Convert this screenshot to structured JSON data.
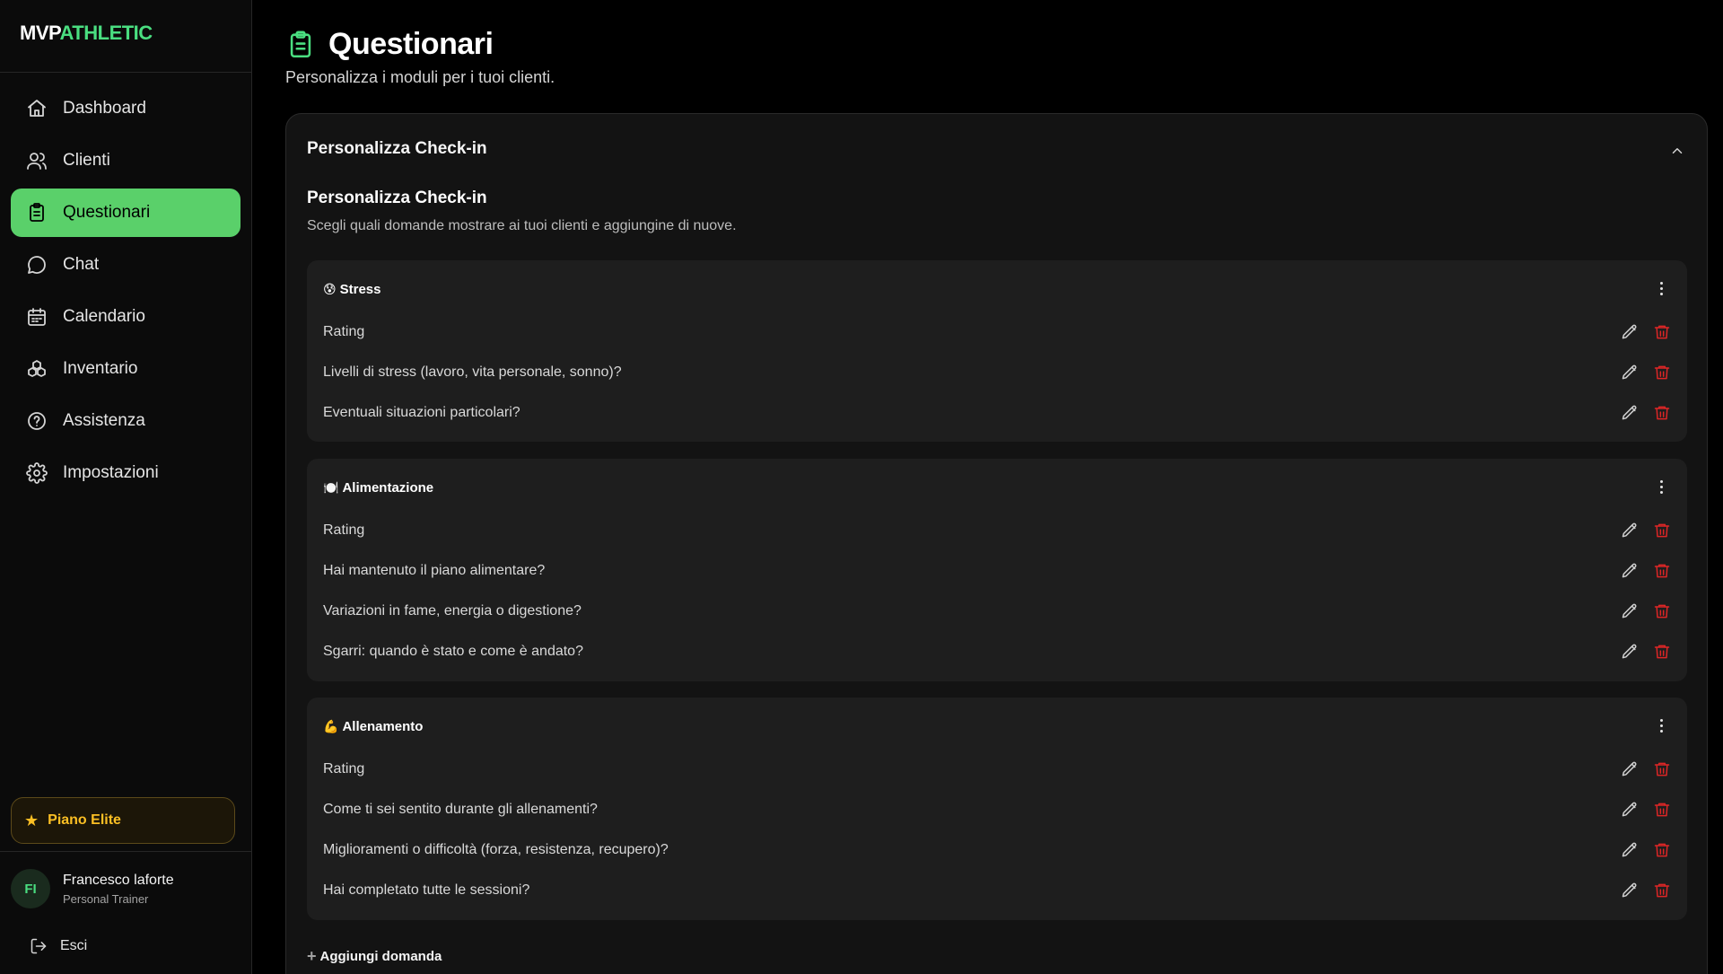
{
  "brand": {
    "part1": "MVP",
    "part2": "ATHLETIC"
  },
  "sidebar": {
    "items": [
      {
        "label": "Dashboard",
        "icon": "home-icon"
      },
      {
        "label": "Clienti",
        "icon": "users-icon"
      },
      {
        "label": "Questionari",
        "icon": "clipboard-icon",
        "active": true
      },
      {
        "label": "Chat",
        "icon": "chat-icon"
      },
      {
        "label": "Calendario",
        "icon": "calendar-icon"
      },
      {
        "label": "Inventario",
        "icon": "inventory-icon"
      },
      {
        "label": "Assistenza",
        "icon": "help-icon"
      },
      {
        "label": "Impostazioni",
        "icon": "gear-icon"
      }
    ],
    "plan": "Piano Elite",
    "user": {
      "initials": "FI",
      "name": "Francesco laforte",
      "role": "Personal Trainer"
    },
    "logout": "Esci"
  },
  "header": {
    "title": "Questionari",
    "subtitle": "Personalizza i moduli per i tuoi clienti."
  },
  "card": {
    "title": "Personalizza Check-in",
    "section_title": "Personalizza Check-in",
    "section_desc": "Scegli quali domande mostrare ai tuoi clienti e aggiungine di nuove.",
    "add_label": "Aggiungi domanda"
  },
  "groups": [
    {
      "emoji": "😰",
      "name": "Stress",
      "questions": [
        "Rating",
        "Livelli di stress (lavoro, vita personale, sonno)?",
        "Eventuali situazioni particolari?"
      ]
    },
    {
      "emoji": "🍽️",
      "name": "Alimentazione",
      "questions": [
        "Rating",
        "Hai mantenuto il piano alimentare?",
        "Variazioni in fame, energia o digestione?",
        "Sgarri: quando è stato e come è andato?"
      ]
    },
    {
      "emoji": "💪",
      "name": "Allenamento",
      "questions": [
        "Rating",
        "Come ti sei sentito durante gli allenamenti?",
        "Miglioramenti o difficoltà (forza, resistenza, recupero)?",
        "Hai completato tutte le sessioni?"
      ]
    }
  ],
  "colors": {
    "accent": "#4ade80",
    "active_bg": "#5ad06a",
    "danger": "#dc2626",
    "plan": "#fbbf24"
  }
}
